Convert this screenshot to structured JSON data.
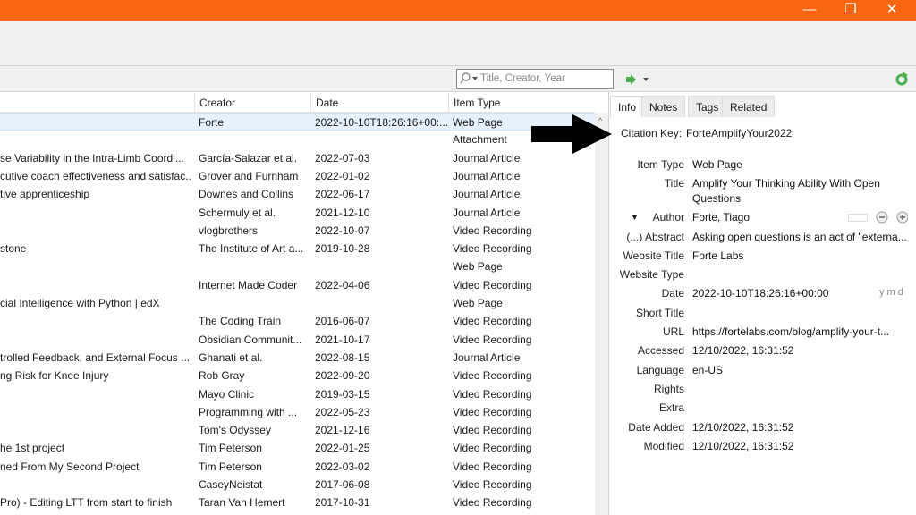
{
  "colors": {
    "titlebar": "#f96611",
    "selected_row": "#e5f1fb",
    "accent_green": "#4caf50"
  },
  "window": {
    "minimize": "—",
    "restore": "❐",
    "close": "✕"
  },
  "search": {
    "placeholder": "Title, Creator, Year"
  },
  "columns": {
    "creator": "Creator",
    "date": "Date",
    "item_type": "Item Type"
  },
  "items": [
    {
      "title": "",
      "creator": "Forte",
      "date": "2022-10-10T18:26:16+00:...",
      "type": "Web Page"
    },
    {
      "title": "",
      "creator": "",
      "date": "",
      "type": "Attachment"
    },
    {
      "title": "se Variability in the Intra-Limb Coordi...",
      "creator": "García-Salazar et al.",
      "date": "2022-07-03",
      "type": "Journal Article"
    },
    {
      "title": "cutive coach effectiveness and satisfac...",
      "creator": "Grover and Furnham",
      "date": "2022-01-02",
      "type": "Journal Article"
    },
    {
      "title": "tive apprenticeship",
      "creator": "Downes and Collins",
      "date": "2022-06-17",
      "type": "Journal Article"
    },
    {
      "title": "",
      "creator": "Schermuly et al.",
      "date": "2021-12-10",
      "type": "Journal Article"
    },
    {
      "title": "",
      "creator": "vlogbrothers",
      "date": "2022-10-07",
      "type": "Video Recording"
    },
    {
      "title": "stone",
      "creator": "The Institute of Art a...",
      "date": "2019-10-28",
      "type": "Video Recording"
    },
    {
      "title": "",
      "creator": "",
      "date": "",
      "type": "Web Page"
    },
    {
      "title": "",
      "creator": "Internet Made Coder",
      "date": "2022-04-06",
      "type": "Video Recording"
    },
    {
      "title": "cial Intelligence with Python | edX",
      "creator": "",
      "date": "",
      "type": "Web Page"
    },
    {
      "title": "",
      "creator": "The Coding Train",
      "date": "2016-06-07",
      "type": "Video Recording"
    },
    {
      "title": "",
      "creator": "Obsidian Communit...",
      "date": "2021-10-17",
      "type": "Video Recording"
    },
    {
      "title": "trolled Feedback, and External Focus ...",
      "creator": "Ghanati et al.",
      "date": "2022-08-15",
      "type": "Journal Article"
    },
    {
      "title": "ng Risk for Knee Injury",
      "creator": "Rob Gray",
      "date": "2022-09-20",
      "type": "Video Recording"
    },
    {
      "title": "",
      "creator": "Mayo Clinic",
      "date": "2019-03-15",
      "type": "Video Recording"
    },
    {
      "title": "",
      "creator": "Programming with ...",
      "date": "2022-05-23",
      "type": "Video Recording"
    },
    {
      "title": "",
      "creator": "Tom's Odyssey",
      "date": "2021-12-16",
      "type": "Video Recording"
    },
    {
      "title": "he 1st project",
      "creator": "Tim Peterson",
      "date": "2022-01-25",
      "type": "Video Recording"
    },
    {
      "title": "ned From My Second Project",
      "creator": "Tim Peterson",
      "date": "2022-03-02",
      "type": "Video Recording"
    },
    {
      "title": "",
      "creator": "CaseyNeistat",
      "date": "2017-06-08",
      "type": "Video Recording"
    },
    {
      "title": " Pro) - Editing LTT from start to finish",
      "creator": "Taran Van Hemert",
      "date": "2017-10-31",
      "type": "Video Recording"
    }
  ],
  "tabs": [
    "Info",
    "Notes",
    "Tags",
    "Related"
  ],
  "citation": {
    "label": "Citation Key:",
    "value": "ForteAmplifyYour2022"
  },
  "fields": [
    {
      "label": "Item Type",
      "value": "Web Page"
    },
    {
      "label": "Title",
      "value": "Amplify Your Thinking Ability With Open"
    },
    {
      "label": "",
      "value": "Questions"
    },
    {
      "label": "Author",
      "value": "Forte, Tiago"
    },
    {
      "label": "(...) Abstract",
      "value": "Asking open questions is an act of \"externa..."
    },
    {
      "label": "Website Title",
      "value": "Forte Labs"
    },
    {
      "label": "Website Type",
      "value": ""
    },
    {
      "label": "Date",
      "value": "2022-10-10T18:26:16+00:00"
    },
    {
      "label": "Short Title",
      "value": ""
    },
    {
      "label": "URL",
      "value": "https://fortelabs.com/blog/amplify-your-t..."
    },
    {
      "label": "Accessed",
      "value": "12/10/2022, 16:31:52"
    },
    {
      "label": "Language",
      "value": "en-US"
    },
    {
      "label": "Rights",
      "value": ""
    },
    {
      "label": "Extra",
      "value": ""
    },
    {
      "label": "Date Added",
      "value": "12/10/2022, 16:31:52"
    },
    {
      "label": "Modified",
      "value": "12/10/2022, 16:31:52"
    }
  ],
  "date_format": "y m d"
}
